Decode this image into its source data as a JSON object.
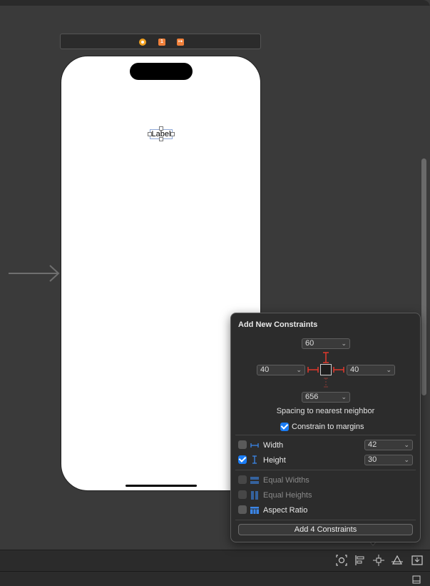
{
  "scene": {
    "label_text": "Label",
    "scene_icons": [
      "view-controller-icon",
      "first-responder-icon",
      "exit-icon"
    ]
  },
  "popover": {
    "title": "Add New Constraints",
    "top_value": "60",
    "left_value": "40",
    "right_value": "40",
    "bottom_value": "656",
    "spacing_caption": "Spacing to nearest neighbor",
    "constrain_margins_label": "Constrain to margins",
    "constrain_margins_checked": true,
    "width_label": "Width",
    "width_checked": false,
    "width_value": "42",
    "height_label": "Height",
    "height_checked": true,
    "height_value": "30",
    "equal_widths_label": "Equal Widths",
    "equal_heights_label": "Equal Heights",
    "aspect_ratio_label": "Aspect Ratio",
    "add_button_label": "Add 4 Constraints"
  },
  "toolbar": {
    "icons": [
      "update-frames-icon",
      "align-icon",
      "add-constraints-icon",
      "resolve-issues-icon",
      "embed-in-icon"
    ]
  },
  "colors": {
    "accent": "#1a7cf5",
    "constraint_red": "#e0382c",
    "scene_orange": "#f0803a"
  }
}
